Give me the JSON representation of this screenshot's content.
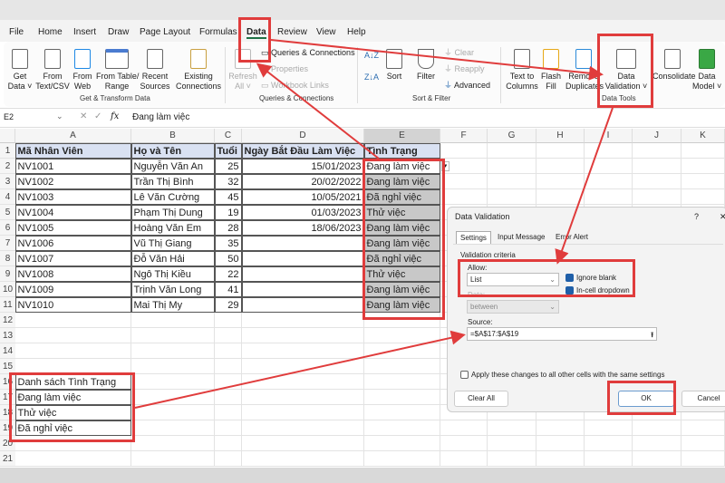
{
  "menu": [
    "File",
    "Home",
    "Insert",
    "Draw",
    "Page Layout",
    "Formulas",
    "Data",
    "Review",
    "View",
    "Help"
  ],
  "ribbon": {
    "get_data": "Get\nData ˅",
    "from_text": "From\nText/CSV",
    "from_web": "From\nWeb",
    "from_table": "From Table/\nRange",
    "recent": "Recent\nSources",
    "existing": "Existing\nConnections",
    "group_get": "Get & Transform Data",
    "refresh": "Refresh\nAll ˅",
    "queries": "Queries & Connections",
    "properties": "Properties",
    "workbook_links": "Workbook Links",
    "group_queries": "Queries & Connections",
    "sort": "Sort",
    "filter": "Filter",
    "clear": "Clear",
    "reapply": "Reapply",
    "advanced": "Advanced",
    "group_sort": "Sort & Filter",
    "text_to_columns": "Text to\nColumns",
    "flash_fill": "Flash\nFill",
    "remove_dup": "Remove\nDuplicates",
    "data_validation": "Data\nValidation ˅",
    "consolidate": "Consolidate",
    "data_model": "Data\nModel ˅",
    "group_tools": "Data Tools"
  },
  "formula_bar": {
    "name_box": "E2",
    "fx": "fx",
    "value": "Đang làm việc"
  },
  "columns": [
    "A",
    "B",
    "C",
    "D",
    "E",
    "F",
    "G",
    "H",
    "I",
    "J",
    "K"
  ],
  "rows": [
    "1",
    "2",
    "3",
    "4",
    "5",
    "6",
    "7",
    "8",
    "9",
    "10",
    "11",
    "12",
    "13",
    "14",
    "15",
    "16",
    "17",
    "18",
    "19",
    "20",
    "21"
  ],
  "table": {
    "headers": [
      "Mã Nhân Viên",
      "Họ và Tên",
      "Tuổi",
      "Ngày Bắt Đầu Làm Việc",
      "Tình Trạng"
    ],
    "data": [
      [
        "NV1001",
        "Nguyễn Văn An",
        "25",
        "15/01/2023",
        "Đang làm việc"
      ],
      [
        "NV1002",
        "Trần Thị Bình",
        "32",
        "20/02/2022",
        "Đang làm việc"
      ],
      [
        "NV1003",
        "Lê Văn Cường",
        "45",
        "10/05/2021",
        "Đã nghỉ việc"
      ],
      [
        "NV1004",
        "Phạm Thị Dung",
        "19",
        "01/03/2023",
        "Thử việc"
      ],
      [
        "NV1005",
        "Hoàng Văn Em",
        "28",
        "18/06/2023",
        "Đang làm việc"
      ],
      [
        "NV1006",
        "Vũ Thị Giang",
        "35",
        "",
        "Đang làm việc"
      ],
      [
        "NV1007",
        "Đỗ Văn Hải",
        "50",
        "",
        "Đã nghỉ việc"
      ],
      [
        "NV1008",
        "Ngô Thị Kiều",
        "22",
        "",
        "Thử việc"
      ],
      [
        "NV1009",
        "Trịnh Văn Long",
        "41",
        "",
        "Đang làm việc"
      ],
      [
        "NV1010",
        "Mai Thị My",
        "29",
        "",
        "Đang làm việc"
      ]
    ]
  },
  "status_list": [
    "Danh sách Tình Trạng",
    "Đang làm việc",
    "Thử việc",
    "Đã nghỉ việc"
  ],
  "dialog": {
    "title": "Data Validation",
    "help": "?",
    "close": "✕",
    "tabs": [
      "Settings",
      "Input Message",
      "Error Alert"
    ],
    "criteria": "Validation criteria",
    "allow_label": "Allow:",
    "allow_value": "List",
    "ignore_blank": "Ignore blank",
    "in_cell": "In-cell dropdown",
    "data_label": "Data:",
    "data_value": "between",
    "source_label": "Source:",
    "source_value": "=$A$17:$A$19",
    "apply_all": "Apply these changes to all other cells with the same settings",
    "clear_all": "Clear All",
    "ok": "OK",
    "cancel": "Cancel"
  },
  "colors": {
    "annotation": "#e03c3c",
    "header_fill": "#d9e1f2",
    "checkbox": "#1f5fa8"
  }
}
